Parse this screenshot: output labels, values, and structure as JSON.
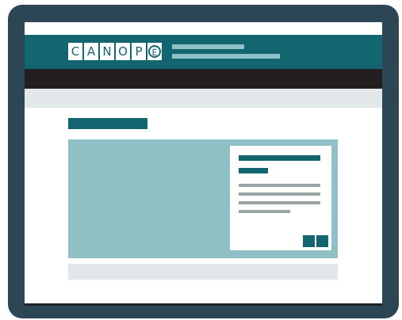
{
  "header": {
    "logo_letters": [
      "C",
      "A",
      "N",
      "O",
      "P",
      "É"
    ],
    "brand_color": "#136570"
  },
  "colors": {
    "device_frame": "#2c4656",
    "header": "#136570",
    "navbar": "#231f20",
    "hero": "#8ec0c6",
    "subbar": "#e2e7ea",
    "text_placeholder": "#9aa3a6"
  },
  "icons": {
    "card_prev": "square-button",
    "card_next": "square-button"
  }
}
